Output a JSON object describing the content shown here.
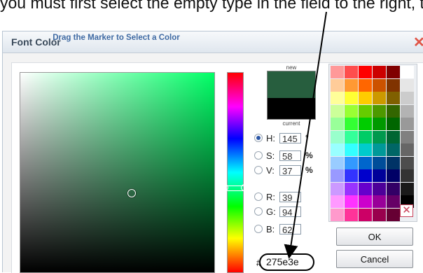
{
  "caption": "you must first select the empty type in the field to the right, then type",
  "dialog": {
    "title": "Font Color",
    "hint": "Drag the Marker to Select a Color",
    "new_label": "new",
    "current_label": "current",
    "new_color": "#275e3e",
    "current_color": "#000000",
    "fields": [
      {
        "label": "H:",
        "value": "145",
        "unit": "°",
        "selected": true
      },
      {
        "label": "S:",
        "value": "58",
        "unit": "%",
        "selected": false
      },
      {
        "label": "V:",
        "value": "37",
        "unit": "%",
        "selected": false
      },
      {
        "label": "R:",
        "value": "39",
        "unit": "",
        "selected": false
      },
      {
        "label": "G:",
        "value": "94",
        "unit": "",
        "selected": false
      },
      {
        "label": "B:",
        "value": "62",
        "unit": "",
        "selected": false
      }
    ],
    "hash_symbol": "#",
    "hex_value": "275e3e",
    "ok_label": "OK",
    "cancel_label": "Cancel",
    "close_icon": "close-icon",
    "palette": [
      [
        "#ff9999",
        "#ff4d4d",
        "#ff0000",
        "#cc0000",
        "#800000",
        "#ffffff"
      ],
      [
        "#ffcc99",
        "#ff9933",
        "#ff6600",
        "#cc5200",
        "#803300",
        "#e6e6e6"
      ],
      [
        "#ffff99",
        "#ffff33",
        "#ffcc00",
        "#cc9900",
        "#806000",
        "#cccccc"
      ],
      [
        "#ccff99",
        "#99ff33",
        "#66cc00",
        "#4d9900",
        "#336600",
        "#b3b3b3"
      ],
      [
        "#99ff99",
        "#33ff33",
        "#00cc00",
        "#009900",
        "#006600",
        "#999999"
      ],
      [
        "#99ffcc",
        "#33ff99",
        "#00cc66",
        "#00994d",
        "#006633",
        "#808080"
      ],
      [
        "#99ffff",
        "#33ffff",
        "#00cccc",
        "#009999",
        "#006666",
        "#666666"
      ],
      [
        "#99ccff",
        "#3399ff",
        "#0066cc",
        "#004d99",
        "#003366",
        "#4d4d4d"
      ],
      [
        "#9999ff",
        "#3333ff",
        "#0000cc",
        "#000099",
        "#000066",
        "#333333"
      ],
      [
        "#cc99ff",
        "#9933ff",
        "#6600cc",
        "#4d0099",
        "#330066",
        "#1a1a1a"
      ],
      [
        "#ff99ff",
        "#ff33ff",
        "#cc00cc",
        "#990099",
        "#660066",
        "#000000"
      ],
      [
        "#ff99cc",
        "#ff3399",
        "#cc0066",
        "#99004d",
        "#660033",
        "none"
      ]
    ]
  }
}
